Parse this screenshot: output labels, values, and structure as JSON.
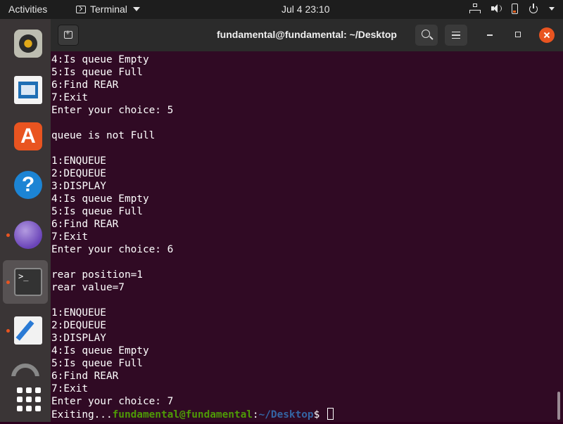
{
  "topbar": {
    "activities": "Activities",
    "app_name": "Terminal",
    "clock": "Jul 4  23:10"
  },
  "dock": {
    "items": [
      "rhythmbox-icon",
      "libreoffice-writer-icon",
      "ubuntu-software-icon",
      "help-icon",
      "browser-icon",
      "terminal-icon",
      "text-editor-icon",
      "show-apps-icon"
    ],
    "terminal_glyph": ">_"
  },
  "window": {
    "title": "fundamental@fundamental: ~/Desktop"
  },
  "terminal": {
    "lines": [
      "4:Is queue Empty",
      "5:Is queue Full",
      "6:Find REAR",
      "7:Exit",
      "Enter your choice: 5",
      "",
      "queue is not Full",
      "",
      "1:ENQUEUE",
      "2:DEQUEUE",
      "3:DISPLAY",
      "4:Is queue Empty",
      "5:Is queue Full",
      "6:Find REAR",
      "7:Exit",
      "Enter your choice: 6",
      "",
      "rear position=1",
      "rear value=7",
      "",
      "1:ENQUEUE",
      "2:DEQUEUE",
      "3:DISPLAY",
      "4:Is queue Empty",
      "5:Is queue Full",
      "6:Find REAR",
      "7:Exit",
      "Enter your choice: 7"
    ],
    "last_line": {
      "prefix": "Exiting...",
      "user": "fundamental@fundamental",
      "colon": ":",
      "path": "~/Desktop",
      "dollar": "$ "
    }
  }
}
